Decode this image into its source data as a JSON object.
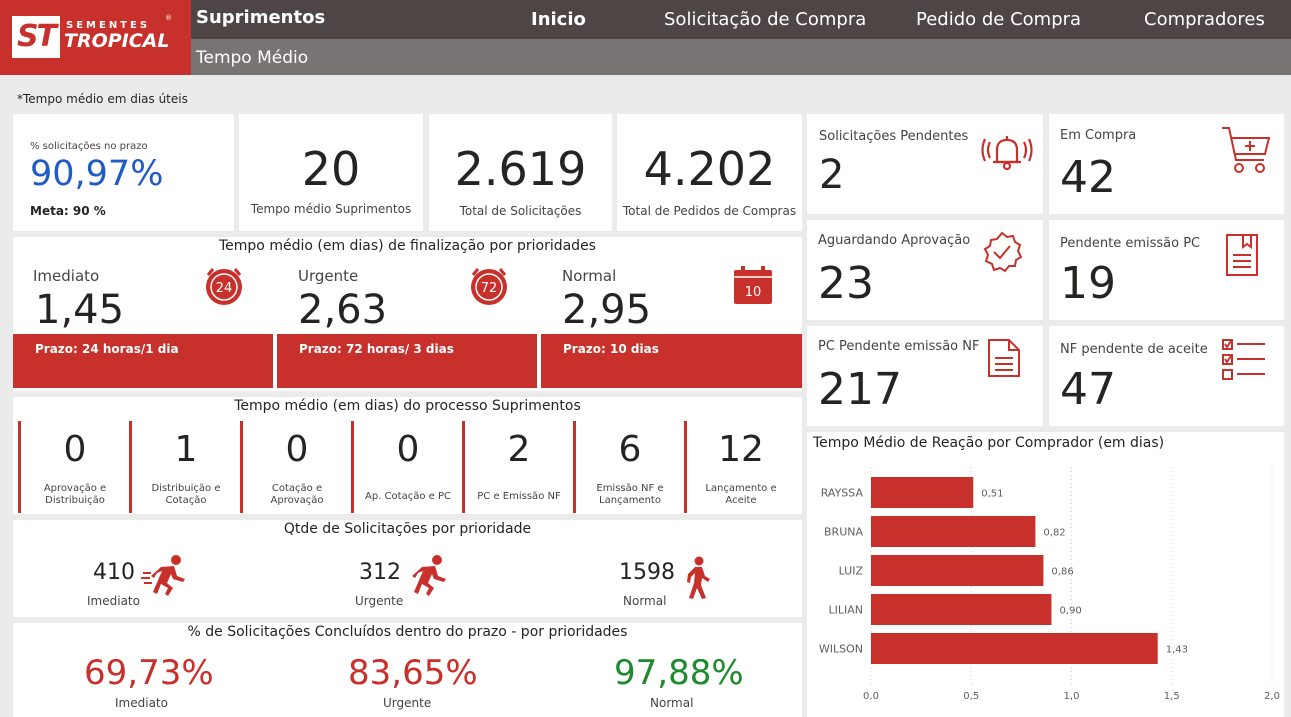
{
  "header": {
    "logo_small": "SEMENTES",
    "logo_large": "TROPICAL",
    "logo_mark": "ST",
    "logo_reg": "®",
    "app_title": "Suprimentos",
    "page_title": "Tempo Médio",
    "nav": [
      "Inicio",
      "Solicitação de Compra",
      "Pedido de Compra",
      "Compradores"
    ]
  },
  "note": "*Tempo médio em dias úteis",
  "kpis": {
    "pct_label": "% solicitações no prazo",
    "pct_value": "90,97%",
    "meta": "Meta: 90 %",
    "tempo_value": "20",
    "tempo_label": "Tempo médio Suprimentos",
    "total_sol_value": "2.619",
    "total_sol_label": "Total de Solicitações",
    "total_ped_value": "4.202",
    "total_ped_label": "Total de Pedidos de Compras"
  },
  "prioridades": {
    "title": "Tempo médio (em dias) de finalização por prioridades",
    "items": [
      {
        "label": "Imediato",
        "value": "1,45",
        "prazo": "Prazo: 24 horas/1 dia",
        "icon_text": "24"
      },
      {
        "label": "Urgente",
        "value": "2,63",
        "prazo": "Prazo: 72 horas/ 3 dias",
        "icon_text": "72"
      },
      {
        "label": "Normal",
        "value": "2,95",
        "prazo": "Prazo: 10 dias",
        "icon_text": "10"
      }
    ]
  },
  "processo": {
    "title": "Tempo médio (em dias) do processo Suprimentos",
    "steps": [
      {
        "value": "0",
        "label": "Aprovação e Distribuição"
      },
      {
        "value": "1",
        "label": "Distribuição e Cotação"
      },
      {
        "value": "0",
        "label": "Cotação e Aprovação"
      },
      {
        "value": "0",
        "label": "Ap. Cotação e PC"
      },
      {
        "value": "2",
        "label": "PC e Emissão NF"
      },
      {
        "value": "6",
        "label": "Emissão NF e Lançamento"
      },
      {
        "value": "12",
        "label": "Lançamento e Aceite"
      }
    ]
  },
  "qtde": {
    "title": "Qtde de Solicitações por prioridade",
    "items": [
      {
        "value": "410",
        "label": "Imediato"
      },
      {
        "value": "312",
        "label": "Urgente"
      },
      {
        "value": "1598",
        "label": "Normal"
      }
    ]
  },
  "concluidos": {
    "title": "% de Solicitações Concluídos dentro do prazo - por prioridades",
    "items": [
      {
        "value": "69,73%",
        "label": "Imediato",
        "color": "#c8302b"
      },
      {
        "value": "83,65%",
        "label": "Urgente",
        "color": "#c8302b"
      },
      {
        "value": "97,88%",
        "label": "Normal",
        "color": "#1e8a2e"
      }
    ]
  },
  "status": {
    "sol_pend_label": "Solicitações Pendentes",
    "sol_pend_value": "2",
    "em_compra_label": "Em Compra",
    "em_compra_value": "42",
    "aguard_label": "Aguardando Aprovação",
    "aguard_value": "23",
    "pend_pc_label": "Pendente emissão PC",
    "pend_pc_value": "19",
    "pc_nf_label": "PC Pendente emissão NF",
    "pc_nf_value": "217",
    "nf_aceite_label": "NF pendente de aceite",
    "nf_aceite_value": "47"
  },
  "colors": {
    "accent": "#c8302b",
    "blue": "#1f5cc8",
    "green": "#1e8a2e",
    "header": "#4d4644"
  },
  "chart_data": {
    "type": "bar",
    "orientation": "horizontal",
    "title": "Tempo Médio de Reação por Comprador (em dias)",
    "categories": [
      "RAYSSA",
      "BRUNA",
      "LUIZ",
      "LILIAN",
      "WILSON"
    ],
    "values": [
      0.51,
      0.82,
      0.86,
      0.9,
      1.43
    ],
    "value_labels": [
      "0,51",
      "0,82",
      "0,86",
      "0,90",
      "1,43"
    ],
    "xlim": [
      0,
      2.0
    ],
    "ticks": [
      0,
      0.5,
      1.0,
      1.5,
      2.0
    ],
    "tick_labels": [
      "0,0",
      "0,5",
      "1,0",
      "1,5",
      "2,0"
    ],
    "grid": true,
    "color": "#c8302b"
  }
}
